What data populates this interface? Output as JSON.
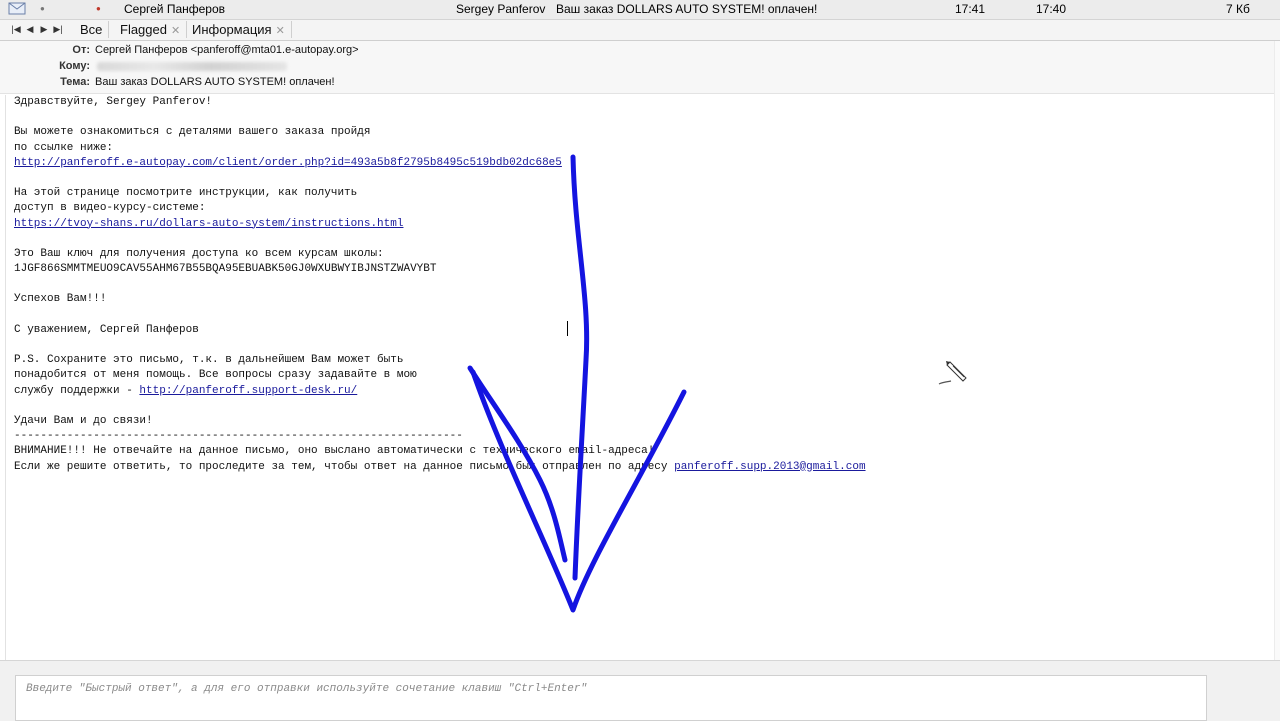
{
  "message_row": {
    "from_name": "Сергей Панферов",
    "sender": "Sergey Panferov",
    "subject": "Ваш заказ DOLLARS AUTO SYSTEM! оплачен!",
    "time_received": "17:41",
    "time_sent": "17:40",
    "size": "7 Кб"
  },
  "tabs": [
    {
      "label": "Все"
    },
    {
      "label": "Flagged"
    },
    {
      "label": "Информация"
    }
  ],
  "headers": {
    "from_label": "От:",
    "from_value": "Сергей Панферов <panferoff@mta01.e-autopay.org>",
    "to_label": "Кому:",
    "subject_label": "Тема:",
    "subject_value": "Ваш заказ DOLLARS AUTO SYSTEM! оплачен!"
  },
  "body": {
    "greeting": "Здравствуйте, Sergey Panferov!",
    "p1_l1": "Вы можете ознакомиться с деталями вашего заказа пройдя",
    "p1_l2": "по ссылке ниже:",
    "link_order": "http://panferoff.e-autopay.com/client/order.php?id=493a5b8f2795b8495c519bdb02dc68e5",
    "p2_l1": "На этой странице посмотрите инструкции, как получить",
    "p2_l2": "доступ в видео-курсу-системе:",
    "link_instructions": "https://tvoy-shans.ru/dollars-auto-system/instructions.html",
    "p3_l1": "Это Ваш ключ для получения доступа ко всем курсам школы:",
    "key": "1JGF866SMMTMEUO9CAV55AHM67B55BQA95EBUABK50GJ0WXUBWYIBJNSTZWAVYBT",
    "luck": "Успехов Вам!!!",
    "regards": "С уважением, Сергей Панферов",
    "ps_l1": "P.S. Сохраните это письмо, т.к. в дальнейшем Вам может быть",
    "ps_l2": "понадобится от меня помощь. Все вопросы сразу задавайте в мою",
    "ps_l3_prefix": "службу поддержки - ",
    "link_support": "http://panferoff.support-desk.ru/",
    "goodbye": "Удачи Вам и до связи!",
    "divider": "--------------------------------------------------------------------",
    "warning": "ВНИМАНИЕ!!! Не отвечайте на данное письмо, оно выслано автоматически с технического email-адреса!",
    "reply_note_prefix": "Если же решите ответить, то проследите за тем, чтобы ответ на данное письмо был отправлен по адресу ",
    "link_email": "panferoff.supp.2013@gmail.com"
  },
  "reply": {
    "placeholder": "Введите \"Быстрый ответ\", а для его отправки используйте сочетание клавиш \"Ctrl+Enter\""
  },
  "colors": {
    "link": "#1a1a9c",
    "annotation_arrow": "#1414e0"
  },
  "icons": [
    "envelope-icon",
    "first-icon",
    "prev-icon",
    "next-icon",
    "last-icon",
    "close-icon",
    "pen-cursor-icon"
  ]
}
